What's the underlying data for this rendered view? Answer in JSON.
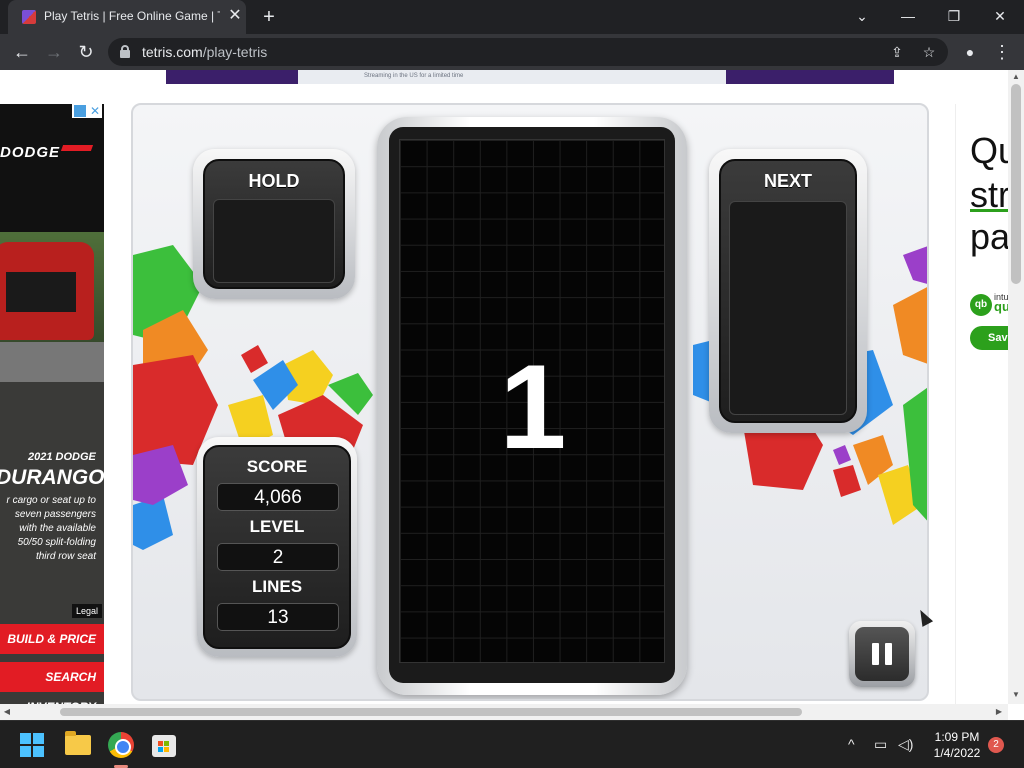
{
  "browser": {
    "tab_title": "Play Tetris | Free Online Game | Te",
    "tab_close": "✕",
    "new_tab": "+",
    "url_host": "tetris.com",
    "url_path": "/play-tetris",
    "controls": {
      "minimize": "—",
      "restore": "❐",
      "close": "✕",
      "dropdown": "⌄"
    },
    "nav": {
      "back": "←",
      "forward": "→",
      "reload": "↻"
    },
    "omni": {
      "share": "⇪",
      "star": "☆",
      "profile": "●",
      "menu": "⋮"
    }
  },
  "top_banner": {
    "text": "Streaming in the US for a limited time"
  },
  "left_ad": {
    "brand": "DODGE",
    "year": "2021 DODGE",
    "model": "DURANGO",
    "copy": [
      "r cargo or seat up to",
      "seven passengers",
      "with the available",
      "50/50 split-folding",
      "third row seat"
    ],
    "legal": "Legal",
    "cta1": "BUILD & PRICE",
    "cta2": "SEARCH INVENTORY"
  },
  "right_ad": {
    "line1": "Qu",
    "line2": "str",
    "line3": "pa",
    "brand_small": "intuit",
    "brand": "qu",
    "button": "Save"
  },
  "game": {
    "hold_label": "HOLD",
    "next_label": "NEXT",
    "score_label": "SCORE",
    "score_value": "4,066",
    "level_label": "LEVEL",
    "level_value": "2",
    "lines_label": "LINES",
    "lines_value": "13",
    "countdown": "1",
    "colors": {
      "red": "#d92b2b",
      "orange": "#f08a24",
      "yellow": "#f5d020",
      "green": "#3cbf3c",
      "blue": "#2f8fe8",
      "purple": "#9b3fc9"
    }
  },
  "taskbar": {
    "time": "1:09 PM",
    "date": "1/4/2022",
    "notifications": "2",
    "tray_up": "^"
  }
}
